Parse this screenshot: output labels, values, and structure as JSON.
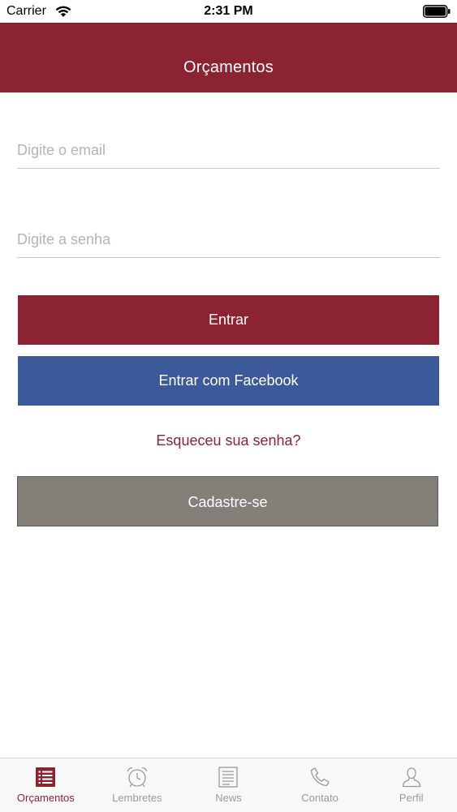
{
  "status_bar": {
    "carrier": "Carrier",
    "time": "2:31 PM"
  },
  "nav": {
    "title": "Orçamentos"
  },
  "form": {
    "email_placeholder": "Digite o email",
    "email_value": "",
    "password_placeholder": "Digite a senha",
    "password_value": "",
    "login_label": "Entrar",
    "facebook_label": "Entrar com Facebook",
    "forgot_label": "Esqueceu sua senha?",
    "signup_label": "Cadastre-se"
  },
  "tabs": [
    {
      "label": "Orçamentos",
      "icon": "list-icon",
      "active": true
    },
    {
      "label": "Lembretes",
      "icon": "alarm-clock-icon",
      "active": false
    },
    {
      "label": "News",
      "icon": "newspaper-icon",
      "active": false
    },
    {
      "label": "Contato",
      "icon": "phone-icon",
      "active": false
    },
    {
      "label": "Perfil",
      "icon": "user-icon",
      "active": false
    }
  ],
  "colors": {
    "brand": "#8b2332",
    "facebook": "#3c5a9a",
    "signup": "#857f79",
    "tab_inactive": "#999999"
  }
}
